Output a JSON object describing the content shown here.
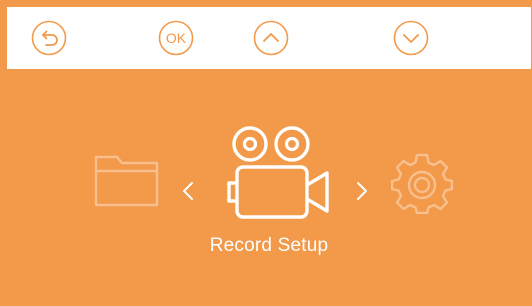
{
  "topbar": {
    "buttons": [
      {
        "id": "back",
        "icon": "back-arrow-icon"
      },
      {
        "id": "ok",
        "label": "OK"
      },
      {
        "id": "up",
        "icon": "chevron-up-icon"
      },
      {
        "id": "down",
        "icon": "chevron-down-icon"
      }
    ]
  },
  "carousel": {
    "left_item_icon": "folder-icon",
    "selected_item_icon": "video-camera-icon",
    "right_item_icon": "gear-icon",
    "selected_label": "Record Setup"
  },
  "colors": {
    "background": "#f2994a",
    "topbar": "#ffffff",
    "icon_active": "#ffffff",
    "icon_dim": "#f8c08e"
  }
}
